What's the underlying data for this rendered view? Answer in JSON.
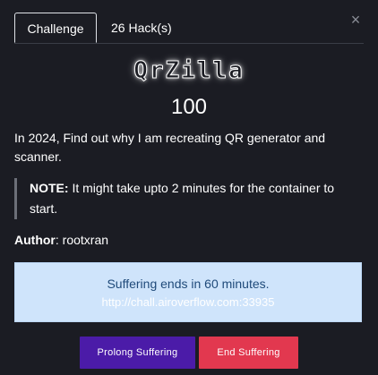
{
  "tabs": [
    {
      "label": "Challenge"
    },
    {
      "label": "26 Hack(s)"
    }
  ],
  "close": {
    "icon": "close-icon",
    "glyph": "×"
  },
  "challenge": {
    "title": "QrZilla",
    "value": "100",
    "description": "In 2024, Find out why I am recreating QR generator and scanner.",
    "note_label": "NOTE:",
    "note_text": " It might take upto 2 minutes for the container to start.",
    "author_label": "Author",
    "author_value": ": rootxran"
  },
  "alert": {
    "message": "Suffering ends in 60 minutes.",
    "url": "http://chall.airoverflow.com:33935"
  },
  "buttons": {
    "prolong": "Prolong Suffering",
    "end": "End Suffering"
  },
  "colors": {
    "background": "#1b1c23",
    "alert_bg": "#cfe4fb",
    "alert_text": "#1f4a7a",
    "prolong_bg": "#4b1ba8",
    "end_bg": "#e2384f"
  }
}
